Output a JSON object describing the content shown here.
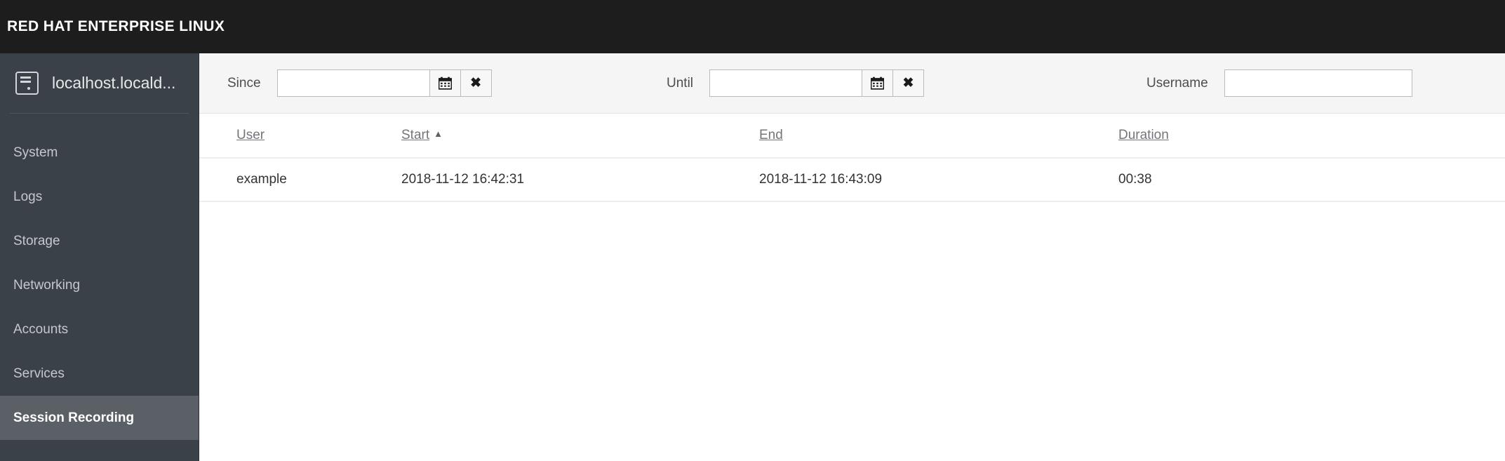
{
  "brand": {
    "title": "RED HAT ENTERPRISE LINUX",
    "bar_color": "#1d1d1d"
  },
  "sidebar": {
    "host": {
      "name": "localhost.locald...",
      "icon": "server-icon"
    },
    "items": [
      {
        "label": "System",
        "active": false
      },
      {
        "label": "Logs",
        "active": false
      },
      {
        "label": "Storage",
        "active": false
      },
      {
        "label": "Networking",
        "active": false
      },
      {
        "label": "Accounts",
        "active": false
      },
      {
        "label": "Services",
        "active": false
      },
      {
        "label": "Session Recording",
        "active": true
      }
    ],
    "background": "#3b4148",
    "active_background": "#5a6066"
  },
  "filters": {
    "since": {
      "label": "Since",
      "value": "",
      "placeholder": "",
      "calendar_icon": "calendar-icon",
      "clear_icon": "times-icon"
    },
    "until": {
      "label": "Until",
      "value": "",
      "placeholder": "",
      "calendar_icon": "calendar-icon",
      "clear_icon": "times-icon"
    },
    "username": {
      "label": "Username",
      "value": "",
      "placeholder": ""
    }
  },
  "table": {
    "columns": [
      {
        "key": "user",
        "label": "User",
        "sorted": false,
        "sort_dir": ""
      },
      {
        "key": "start",
        "label": "Start",
        "sorted": true,
        "sort_dir": "asc",
        "caret": "▲"
      },
      {
        "key": "end",
        "label": "End",
        "sorted": false,
        "sort_dir": ""
      },
      {
        "key": "duration",
        "label": "Duration",
        "sorted": false,
        "sort_dir": ""
      }
    ],
    "rows": [
      {
        "user": "example",
        "start": "2018-11-12 16:42:31",
        "end": "2018-11-12 16:43:09",
        "duration": "00:38"
      }
    ]
  }
}
